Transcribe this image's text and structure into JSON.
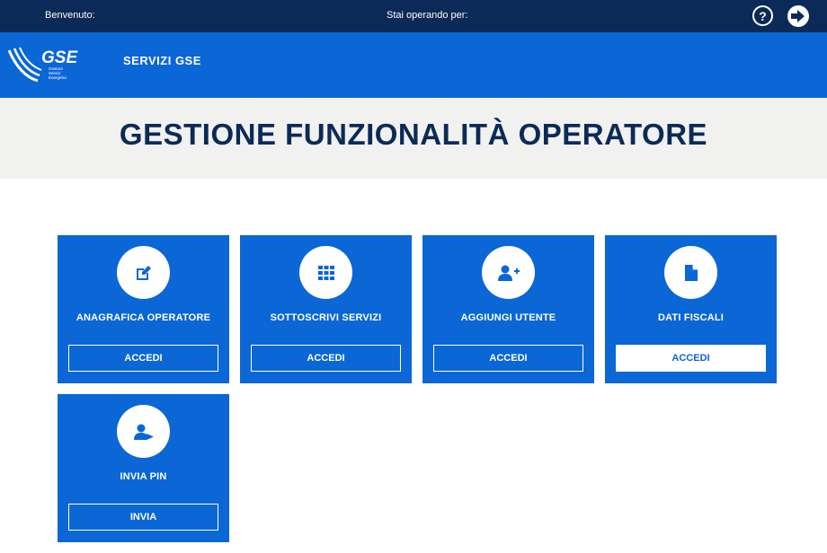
{
  "topbar": {
    "welcome": "Benvenuto: ",
    "operating_for": "Stai operando per: "
  },
  "header": {
    "logo_text": "GSE",
    "logo_sub": [
      "Gestore",
      "Servizi",
      "Energetici"
    ],
    "services_link": "SERVIZI GSE"
  },
  "page": {
    "title": "GESTIONE FUNZIONALITÀ OPERATORE"
  },
  "cards": [
    {
      "title": "ANAGRAFICA OPERATORE",
      "button": "ACCEDI",
      "icon": "edit-icon"
    },
    {
      "title": "SOTTOSCRIVI SERVIZI",
      "button": "ACCEDI",
      "icon": "grid-icon"
    },
    {
      "title": "AGGIUNGI UTENTE",
      "button": "ACCEDI",
      "icon": "add-user-icon"
    },
    {
      "title": "DATI FISCALI",
      "button": "ACCEDI",
      "icon": "document-icon"
    },
    {
      "title": "INVIA PIN",
      "button": "INVIA",
      "icon": "user-send-icon"
    }
  ],
  "colors": {
    "topbar": "#0b2a57",
    "header": "#0b66d6",
    "card": "#0b66d6",
    "title": "#0b2a57",
    "band": "#f1f1ef"
  }
}
